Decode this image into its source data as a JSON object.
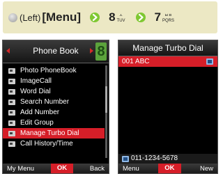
{
  "instruction": {
    "prefix": "(Left)",
    "menu_key": "[Menu]",
    "step1_digit": "8",
    "step1_sub_top": "ㅅ",
    "step1_sub": "TUV",
    "step2_digit": "7",
    "step2_sub_top": "ㅂㅍ",
    "step2_sub": "PQRS"
  },
  "screen_a": {
    "title": "Phone Book",
    "number_badge": "8",
    "menu_items": [
      {
        "label": "Photo PhoneBook"
      },
      {
        "label": "ImageCall"
      },
      {
        "label": "Word Dial"
      },
      {
        "label": "Search Number"
      },
      {
        "label": "Add Number"
      },
      {
        "label": "Edit Group"
      },
      {
        "label": "Manage Turbo Dial",
        "selected": true
      },
      {
        "label": "Call History/Time"
      }
    ],
    "softkeys": {
      "left": "My Menu",
      "center": "OK",
      "right": "Back"
    }
  },
  "screen_b": {
    "title": "Manage Turbo Dial",
    "entry": "001 ABC",
    "number": "011-1234-5678",
    "softkeys": {
      "left": "Menu",
      "center": "OK",
      "right": "New"
    }
  },
  "colors": {
    "highlight": "#d61e28",
    "instruction_bg": "#ece8c4",
    "arrow_green": "#7fc832"
  }
}
